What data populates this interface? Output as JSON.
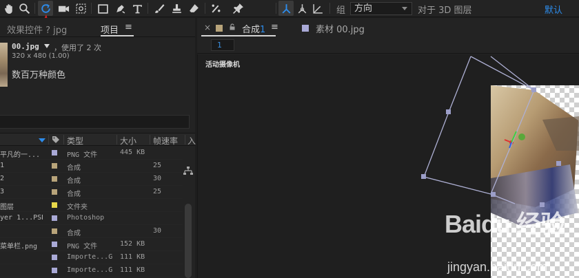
{
  "toolbar": {
    "group_label": "组",
    "direction_value": "方向",
    "align_3d_label": "对于 3D 图层",
    "default_label": "默认",
    "icons": [
      "hand-tool-icon",
      "zoom-tool-icon",
      "rotate-tool-icon",
      "camera-tool-icon",
      "pan-behind-tool-icon",
      "rectangle-tool-icon",
      "pen-tool-icon",
      "text-tool-icon",
      "brush-tool-icon",
      "clone-stamp-tool-icon",
      "eraser-tool-icon",
      "roto-brush-tool-icon",
      "puppet-pin-tool-icon",
      "local-axis-mode-icon",
      "world-axis-mode-icon",
      "view-axis-mode-icon"
    ]
  },
  "left_panel": {
    "tab_effects": "效果控件 ? jpg",
    "tab_project": "项目",
    "tab_menu": "≡",
    "file_name": "00.jpg",
    "file_usage": "，使用了 2 次",
    "file_dimensions": "320 x 480 (1.00)",
    "file_colors": "数百万种颜色",
    "columns": {
      "type": "类型",
      "size": "大小",
      "fps": "帧速率",
      "in": "入"
    },
    "rows": [
      {
        "name": "平凡的一...",
        "label_color": "#a9a9d6",
        "type": "PNG 文件",
        "size": "445 KB",
        "fps": ""
      },
      {
        "name": "1",
        "label_color": "#b8a47a",
        "type": "合成",
        "size": "",
        "fps": "25"
      },
      {
        "name": "2",
        "label_color": "#b8a47a",
        "type": "合成",
        "size": "",
        "fps": "30"
      },
      {
        "name": "3",
        "label_color": "#b8a47a",
        "type": "合成",
        "size": "",
        "fps": "25"
      },
      {
        "name": "图层",
        "label_color": "#e8d84a",
        "type": "文件夹",
        "size": "",
        "fps": ""
      },
      {
        "name": "yer 1...PSD",
        "label_color": "#a9a9d6",
        "type": "Photoshop",
        "size": "",
        "fps": ""
      },
      {
        "name": "",
        "label_color": "#b8a47a",
        "type": "合成",
        "size": "",
        "fps": "30"
      },
      {
        "name": "菜单栏.png",
        "label_color": "#a9a9d6",
        "type": "PNG 文件",
        "size": "152 KB",
        "fps": ""
      },
      {
        "name": "",
        "label_color": "#a9a9d6",
        "type": "Importe...G",
        "size": "111 KB",
        "fps": ""
      },
      {
        "name": "",
        "label_color": "#a9a9d6",
        "type": "Importe...G",
        "size": "111 KB",
        "fps": ""
      }
    ]
  },
  "comp_panel": {
    "close": "×",
    "comp_name": "合成",
    "comp_number": "1",
    "menu": "≡",
    "footage_tab": "素材 00.jpg",
    "sub_tab": "1",
    "camera_label": "活动摄像机",
    "comp_swatch_color": "#b8a47a",
    "footage_swatch_color": "#a9a9d6"
  },
  "watermark": {
    "main": "Baidu 经验",
    "sub": "jingyan.baidu.com"
  }
}
